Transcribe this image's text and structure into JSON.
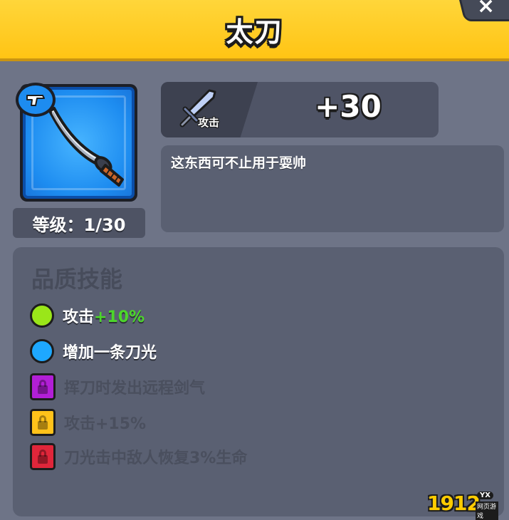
{
  "header": {
    "title": "太刀",
    "close_icon": "×"
  },
  "item": {
    "icon": "katana-icon",
    "badge_icon": "hand-gun-icon",
    "level_text": "等级：1/30"
  },
  "stats": {
    "attack_icon": "sword-icon",
    "attack_label": "攻击",
    "attack_value": "+30"
  },
  "description": "这东西可不止用于耍帅",
  "skills": {
    "title": "品质技能",
    "items": [
      {
        "prefix": "攻击",
        "highlight": "+10%",
        "unlocked": true,
        "color": "#9ae619"
      },
      {
        "prefix": "增加一条刀光",
        "highlight": "",
        "unlocked": true,
        "color": "#1ea8ff"
      },
      {
        "prefix": "挥刀时发出远程剑气",
        "highlight": "",
        "unlocked": false,
        "color": "#b21fd6"
      },
      {
        "prefix": "攻击+15%",
        "highlight": "",
        "unlocked": false,
        "color": "#ffc21a"
      },
      {
        "prefix": "刀光击中敌人恢复3%生命",
        "highlight": "",
        "unlocked": false,
        "color": "#e0263a"
      }
    ]
  },
  "watermark": {
    "number": "1912",
    "badge": "YX",
    "sub": "网页游戏"
  }
}
